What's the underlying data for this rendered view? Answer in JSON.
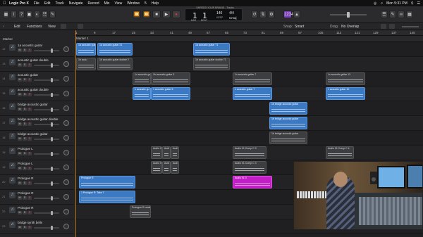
{
  "menubar": {
    "app": "Logic Pro X",
    "items": [
      "File",
      "Edit",
      "Track",
      "Navigate",
      "Record",
      "Mix",
      "View",
      "Window",
      "5",
      "Help"
    ],
    "clock": "Mon 5:31 PM"
  },
  "window_title": "SHREDD YOUR BRAINS - Tracks",
  "lcd": {
    "bar": "1",
    "beat": "1",
    "tempo": "140",
    "signature": "4/4",
    "key": "Cmaj",
    "label_bar": "BAR",
    "label_beat": "BEAT",
    "label_tempo": "KEEP",
    "label_tempo2": "TEMPO"
  },
  "subbar": {
    "edit": "Edit",
    "functions": "Functions",
    "view": "View",
    "snap_label": "Snap:",
    "snap_value": "Smart",
    "drag_label": "Drag:",
    "drag_value": "No Overlap"
  },
  "ruler": [
    "1",
    "9",
    "17",
    "25",
    "33",
    "41",
    "49",
    "57",
    "65",
    "73",
    "81",
    "89",
    "97",
    "105",
    "113",
    "121",
    "129",
    "137",
    "145"
  ],
  "marker_header": "Marker",
  "marker_label": "Marker 1",
  "tracks": [
    {
      "num": "12",
      "name": "1a acoustic guitar"
    },
    {
      "num": "13",
      "name": "acoustic guitar double"
    },
    {
      "num": "14",
      "name": "acoustic guitar"
    },
    {
      "num": "15",
      "name": "acoustic guitar double"
    },
    {
      "num": "16",
      "name": "bridge acoustic guitar"
    },
    {
      "num": "17",
      "name": "bridge acoustic guitar double"
    },
    {
      "num": "18",
      "name": "bridge acoustic guitar"
    },
    {
      "num": "19",
      "name": "Prologue L"
    },
    {
      "num": "19",
      "name": "Prologue L"
    },
    {
      "num": "20",
      "name": "Prologue R"
    },
    {
      "num": "21",
      "name": "Prologue R"
    },
    {
      "num": "22",
      "name": "Prologue R"
    },
    {
      "num": "23",
      "name": "bridge synth bells"
    }
  ],
  "track_buttons": {
    "m": "M",
    "s": "S",
    "r": "R"
  },
  "regions": {
    "r1": "1a acoustic guit",
    "r2": "1a acoustic guitar 21",
    "r3": "1a acoustic guitar 71",
    "r4": "1b acou",
    "r5": "1b acoustic guitar double 2",
    "r6": "1b acoustic guitar double 71",
    "r7": "1c acoustic gu",
    "r8": "1b acoustic guitar 3",
    "r9": "1c acoustic guitar 7",
    "r10": "1c acoustic guitar 13",
    "r11": "1 acoustic gu",
    "r12": "1 acoustic guitar 5",
    "r13": "1 acoustic guitar 7",
    "r14": "1 acoustic guitar 10",
    "r15": "1b bridge acoustic guitar",
    "r16": "1b bridge acoustic guitar",
    "r17": "1b bridge acoustic guitar",
    "r18": "Audio 01",
    "r19": "Audi",
    "r20": "Audi",
    "r21": "Audio 01 Comp C 3",
    "r22": "Audio 01 Comp C 4",
    "r23": "Audio 01",
    "r24": "Audi",
    "r25": "Audi",
    "r26": "Audio 01 Comp C 3",
    "r27": "Audio 01 Comp C 4",
    "r28": "Prologue R",
    "r29": "Audio 01 3",
    "r30": "1 Prologue R: Take 7",
    "r31": "Prologue R recat"
  },
  "colors": {
    "accent": "#e8a23a",
    "region_blue": "#3b79c3",
    "region_magenta": "#c21ec5",
    "region_grey": "#3d3e42"
  }
}
